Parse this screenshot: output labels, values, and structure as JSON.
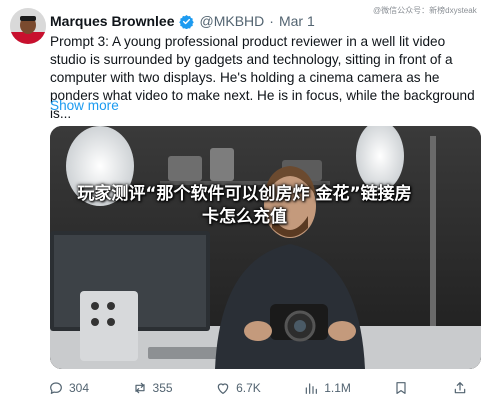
{
  "tweet": {
    "author_name": "Marques Brownlee",
    "handle": "@MKBHD",
    "separator": "·",
    "date": "Mar 1",
    "text": "Prompt 3: A young professional product reviewer in a well lit video studio is surrounded by gadgets and technology, sitting in front of a computer with two displays. He's holding a cinema camera as he ponders what video to make next. He is in focus, while the background is...",
    "show_more": "Show more",
    "watermark": "@微信公众号：新榜dxysteak"
  },
  "media": {
    "overlay_text": "玩家测评“那个软件可以创房炸 金花”链接房卡怎么充值"
  },
  "actions": {
    "replies": "304",
    "reposts": "355",
    "likes": "6.7K",
    "views": "1.1M"
  },
  "colors": {
    "accent": "#1d9bf0",
    "text": "#0f1419",
    "muted": "#536471"
  },
  "icons": [
    "verified-badge-icon",
    "reply-icon",
    "repost-icon",
    "like-icon",
    "views-icon",
    "bookmark-icon",
    "share-icon"
  ]
}
